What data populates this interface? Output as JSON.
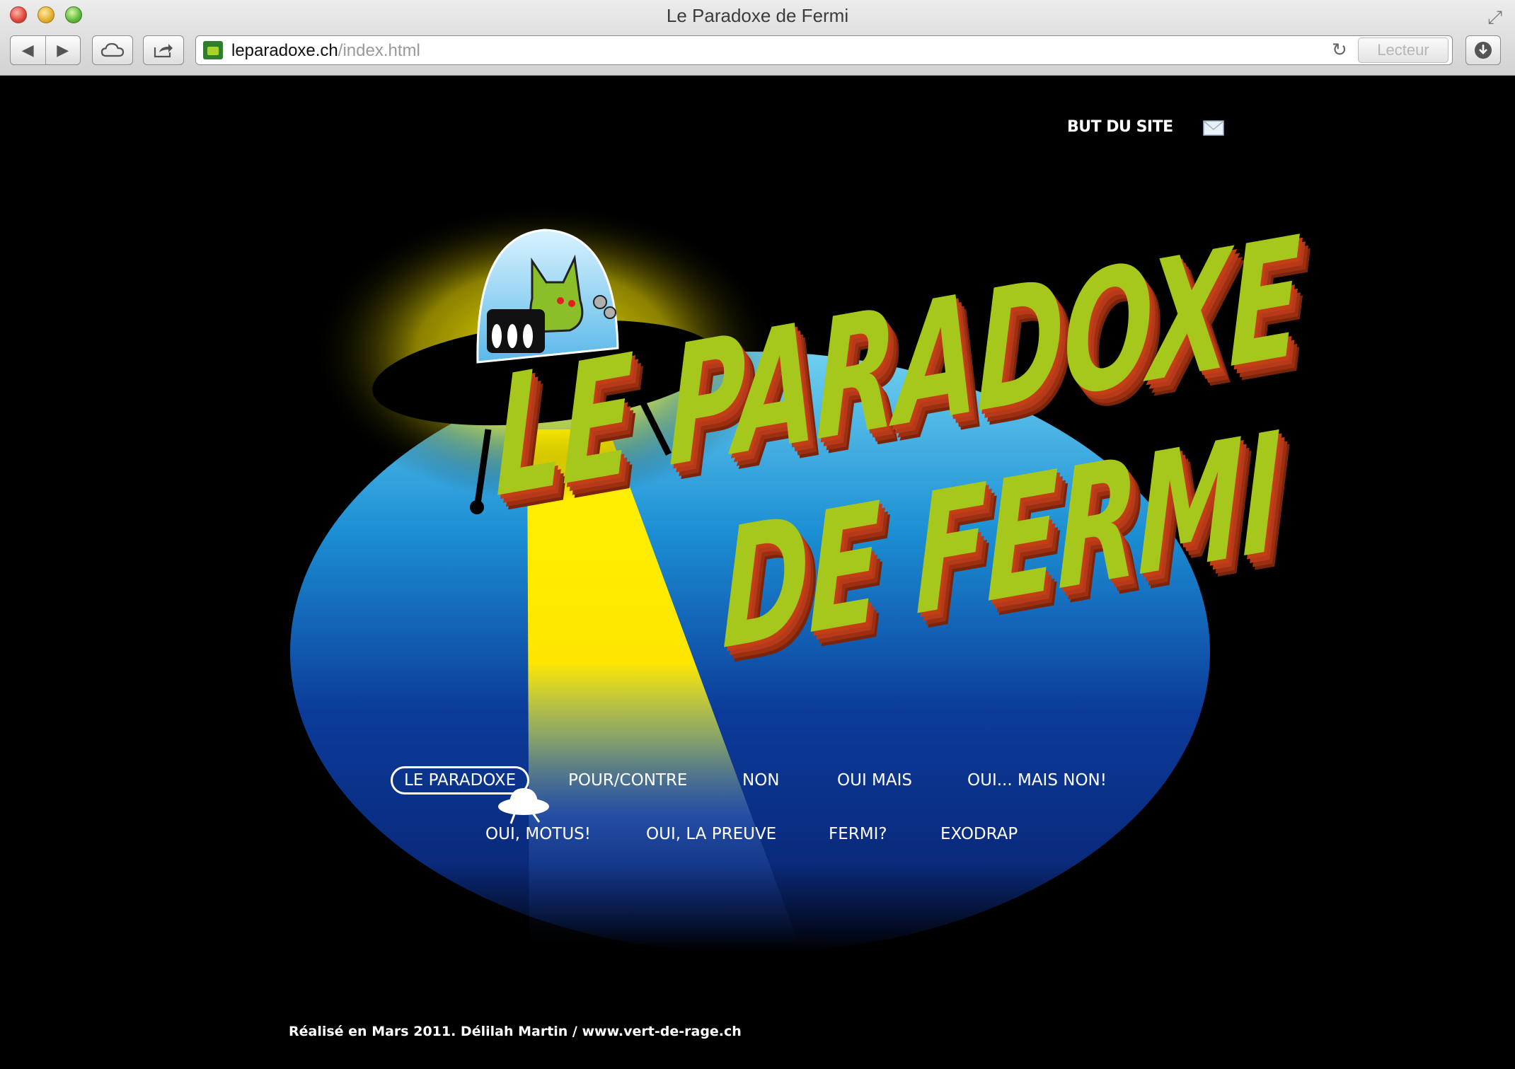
{
  "browser": {
    "window_title": "Le Paradoxe de Fermi",
    "url_host": "leparadoxe.ch",
    "url_path": "/index.html",
    "reader_label": "Lecteur",
    "icons": [
      "back-icon",
      "forward-icon",
      "cloud-icon",
      "share-icon",
      "reload-icon",
      "download-icon",
      "fullscreen-icon"
    ]
  },
  "header": {
    "but_du_site": "BUT DU SITE",
    "mail_icon": "envelope-icon"
  },
  "logo": {
    "line1": "LE PARADOXE",
    "line2": "DE FERMI",
    "colors": {
      "face": "#a6c71b",
      "extrude": "#c23f14",
      "ellipse_top": "#1f9ad8",
      "ellipse_bottom": "#0a2a88",
      "beam": "#ffe600"
    }
  },
  "menu": {
    "row1": [
      "LE PARADOXE",
      "POUR/CONTRE",
      "NON",
      "OUI MAIS",
      "OUI... MAIS NON!"
    ],
    "row2": [
      "OUI, MOTUS!",
      "OUI, LA PREUVE",
      "FERMI?",
      "EXODRAP"
    ]
  },
  "footer": {
    "credit": "Réalisé en Mars 2011. Délilah Martin / www.vert-de-rage.ch"
  }
}
